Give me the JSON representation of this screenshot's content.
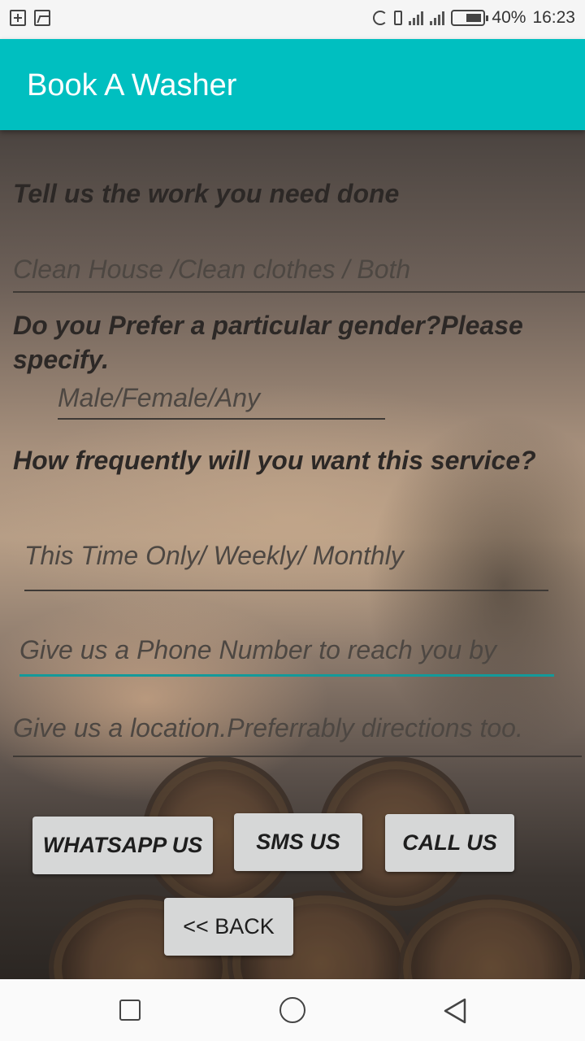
{
  "status_bar": {
    "battery": "40%",
    "time": "16:23"
  },
  "app_bar": {
    "title": "Book A Washer"
  },
  "form": {
    "work_label": "Tell us the work you need done",
    "work_placeholder": "Clean House /Clean clothes / Both",
    "gender_label": "Do you Prefer a particular gender?Please specify.",
    "gender_placeholder": "Male/Female/Any",
    "frequency_label": "How frequently will you want this service?",
    "frequency_placeholder": "This Time Only/ Weekly/ Monthly",
    "phone_placeholder": "Give us a Phone Number to reach you by",
    "location_placeholder": "Give us a location.Preferrably directions too."
  },
  "buttons": {
    "whatsapp": "WHATSAPP US",
    "sms": "SMS US",
    "call": "CALL US",
    "back": "<< BACK"
  },
  "colors": {
    "accent": "#00bfc0",
    "field_focus": "#139a9a",
    "button_bg": "#d6d7d7"
  },
  "icons": [
    "battery-saver-icon",
    "screenshot-icon",
    "sync-icon",
    "vibrate-icon",
    "signal-icon",
    "battery-icon",
    "recent-apps-icon",
    "home-icon",
    "back-icon"
  ]
}
